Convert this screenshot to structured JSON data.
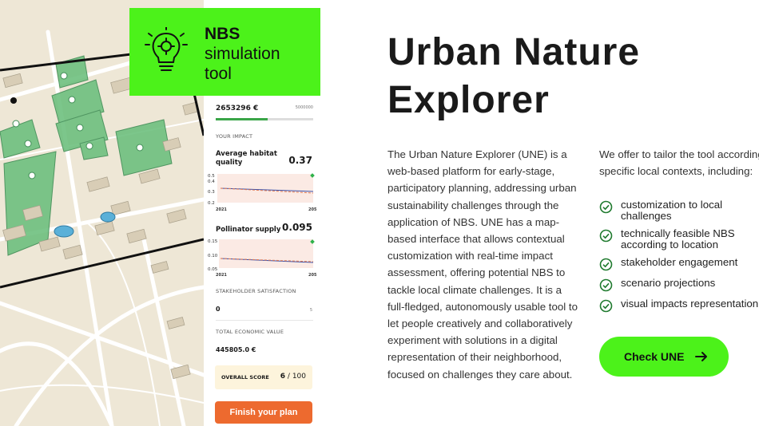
{
  "badge": {
    "title": "NBS",
    "subtitle_line1": "simulation",
    "subtitle_line2": "tool",
    "icon": "lightbulb-gear-icon"
  },
  "panel": {
    "budget_value": "2653296 €",
    "budget_max": "5000000",
    "budget_fraction": 0.53,
    "impact_label": "YOUR IMPACT",
    "habitat": {
      "title_line1": "Average habitat",
      "title_line2": "quality",
      "value": "0.37",
      "y_ticks": [
        "0.5",
        "0.4",
        "0.3",
        "0.2"
      ],
      "x_start": "2021",
      "x_end": "2050"
    },
    "pollinator": {
      "title": "Pollinator supply",
      "value": "0.095",
      "y_ticks": [
        "0.15",
        "0.10",
        "0.05"
      ],
      "x_start": "2021",
      "x_end": "2050"
    },
    "stakeholder": {
      "label": "STAKEHOLDER SATISFACTION",
      "value": "0",
      "max": "5"
    },
    "economic": {
      "label": "TOTAL ECONOMIC VALUE",
      "value": "445805.0 €"
    },
    "score": {
      "label": "OVERALL SCORE",
      "value": "6",
      "sep": " / 100"
    },
    "finish_label": "Finish your plan"
  },
  "main": {
    "title_line1": "Urban Nature",
    "title_line2": "Explorer",
    "description": "The Urban Nature Explorer (UNE) is a web-based platform for early-stage, participatory planning, addressing urban sustainability challenges through the application of NBS. UNE has a map-based interface that allows contextual customization with real-time impact assessment, offering potential NBS to tackle local climate challenges. It is a full-fledged, autonomously usable tool to let people creatively and collaboratively experiment with solutions in a digital representation of their neighborhood, focused on challenges they care about.",
    "offer_line1": "We offer to tailor the tool according to",
    "offer_line2": "specific local contexts, including:",
    "features": [
      {
        "line1": "customization to local",
        "line2": "challenges"
      },
      {
        "line1": "technically feasible NBS",
        "line2": "according to location"
      },
      {
        "line1": "stakeholder engagement",
        "line2": ""
      },
      {
        "line1": "scenario projections",
        "line2": ""
      },
      {
        "line1": "visual impacts representation",
        "line2": ""
      }
    ],
    "cta_label": "Check UNE"
  },
  "colors": {
    "accent_green": "#4cf21a",
    "finish_orange": "#ed6a2f",
    "budget_green": "#3aa548"
  }
}
